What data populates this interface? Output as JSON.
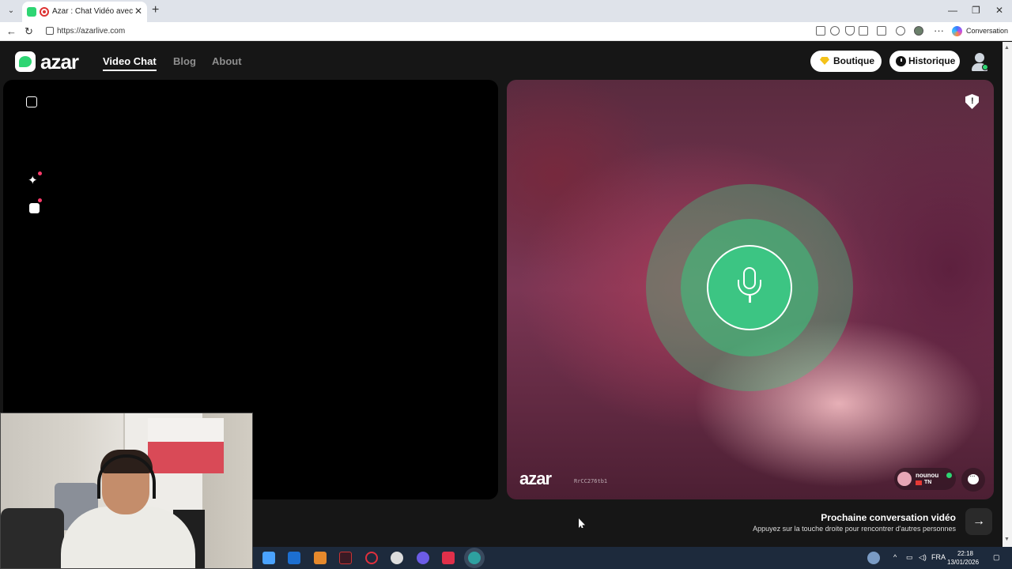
{
  "browser": {
    "tab_title": "Azar : Chat Vidéo avec de nouveaux amis",
    "url": "https://azarlive.com",
    "copilot_label": "Conversation"
  },
  "header": {
    "logo": "azar",
    "nav": [
      {
        "label": "Video Chat",
        "active": true
      },
      {
        "label": "Blog",
        "active": false
      },
      {
        "label": "About",
        "active": false
      }
    ],
    "shop_label": "Boutique",
    "history_label": "Historique"
  },
  "remote": {
    "watermark": "azar",
    "id": "RrCC276tb1",
    "user_name": "nounou",
    "country": "TN",
    "accent": "#3cc583"
  },
  "next": {
    "title": "Prochaine conversation vidéo",
    "subtitle": "Appuyez sur la touche droite pour rencontrer d'autres personnes",
    "arrow": "→"
  },
  "taskbar": {
    "language": "FRA",
    "time": "22:18",
    "date": "13/01/2026"
  }
}
